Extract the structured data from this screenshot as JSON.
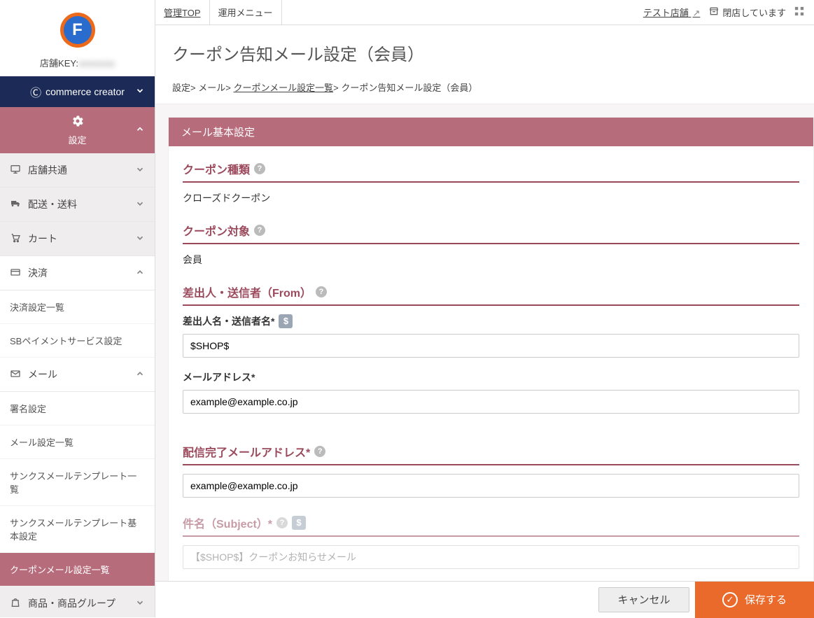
{
  "sidebar": {
    "shop_key_label": "店舗KEY:",
    "shop_key_value": "xxxxxxxx",
    "commerce_creator": "commerce creator",
    "settings_label": "設定",
    "items": [
      {
        "label": "店舗共通",
        "icon": "monitor"
      },
      {
        "label": "配送・送料",
        "icon": "truck"
      },
      {
        "label": "カート",
        "icon": "cart"
      },
      {
        "label": "決済",
        "icon": "card",
        "open": true,
        "children": [
          "決済設定一覧",
          "SBペイメントサービス設定"
        ]
      },
      {
        "label": "メール",
        "icon": "mail",
        "open": true,
        "children": [
          "署名設定",
          "メール設定一覧",
          "サンクスメールテンプレート一覧",
          "サンクスメールテンプレート基本設定",
          "クーポンメール設定一覧"
        ]
      },
      {
        "label": "商品・商品グループ",
        "icon": "bag"
      }
    ],
    "active_sub": "クーポンメール設定一覧"
  },
  "topbar": {
    "admin_top": "管理TOP",
    "op_menu": "運用メニュー",
    "test_store": "テスト店舗",
    "closed": "閉店しています"
  },
  "page": {
    "title": "クーポン告知メール設定（会員）",
    "breadcrumb": {
      "a": "設定",
      "b": "メール",
      "c": "クーポンメール設定一覧",
      "d": "クーポン告知メール設定（会員）"
    }
  },
  "form": {
    "section_title": "メール基本設定",
    "coupon_type": {
      "label": "クーポン種類",
      "value": "クローズドクーポン"
    },
    "coupon_target": {
      "label": "クーポン対象",
      "value": "会員"
    },
    "from_section": {
      "label": "差出人・送信者（From）"
    },
    "sender_name": {
      "label": "差出人名・送信者名*",
      "value": "$SHOP$"
    },
    "mail_addr": {
      "label": "メールアドレス*",
      "value": "example@example.co.jp"
    },
    "delivery_addr": {
      "label": "配信完了メールアドレス*",
      "value": "example@example.co.jp"
    },
    "subject": {
      "label": "件名（Subject）*",
      "placeholder": "【$SHOP$】クーポンお知らせメール"
    }
  },
  "footer": {
    "cancel": "キャンセル",
    "save": "保存する"
  }
}
